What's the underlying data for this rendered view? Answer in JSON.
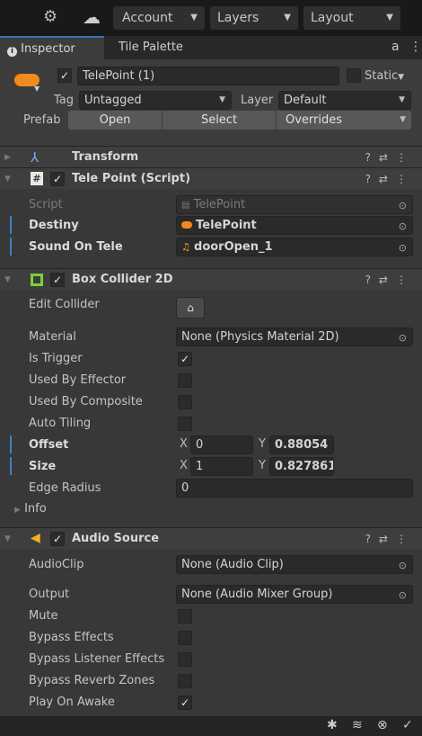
{
  "toolbar": {
    "settings_icon": "⚙",
    "cloud_icon": "☁",
    "account_label": "Account",
    "layers_label": "Layers",
    "layout_label": "Layout"
  },
  "tabs": [
    {
      "label": "Inspector",
      "active": true
    },
    {
      "label": "Tile Palette",
      "active": false
    }
  ],
  "object": {
    "name": "TelePoint (1)",
    "static_label": "Static",
    "tag_label": "Tag",
    "tag_value": "Untagged",
    "layer_label": "Layer",
    "layer_value": "Default",
    "prefab_label": "Prefab",
    "prefab_open": "Open",
    "prefab_select": "Select",
    "prefab_overrides": "Overrides"
  },
  "transform": {
    "title": "Transform"
  },
  "script_comp": {
    "title": "Tele Point (Script)",
    "script_label": "Script",
    "script_value": "TelePoint",
    "destiny_label": "Destiny",
    "destiny_value": "TelePoint",
    "sound_label": "Sound On Tele",
    "sound_value": "doorOpen_1"
  },
  "collider": {
    "title": "Box Collider 2D",
    "edit_label": "Edit Collider",
    "material_label": "Material",
    "material_value": "None (Physics Material 2D)",
    "trigger_label": "Is Trigger",
    "effector_label": "Used By Effector",
    "composite_label": "Used By Composite",
    "tiling_label": "Auto Tiling",
    "offset_label": "Offset",
    "offset_x": "0",
    "offset_y": "0.88054",
    "size_label": "Size",
    "size_x": "1",
    "size_y": "0.827861",
    "edge_label": "Edge Radius",
    "edge_value": "0",
    "info_label": "Info",
    "x_label": "X",
    "y_label": "Y"
  },
  "audio": {
    "title": "Audio Source",
    "clip_label": "AudioClip",
    "clip_value": "None (Audio Clip)",
    "output_label": "Output",
    "output_value": "None (Audio Mixer Group)",
    "mute_label": "Mute",
    "bypass_effects_label": "Bypass Effects",
    "bypass_listener_label": "Bypass Listener Effects",
    "bypass_reverb_label": "Bypass Reverb Zones",
    "play_awake_label": "Play On Awake"
  },
  "colors": {
    "accent": "#3d80c8",
    "object_icon": "#f28a1e",
    "collider_icon": "#7cd23a"
  }
}
